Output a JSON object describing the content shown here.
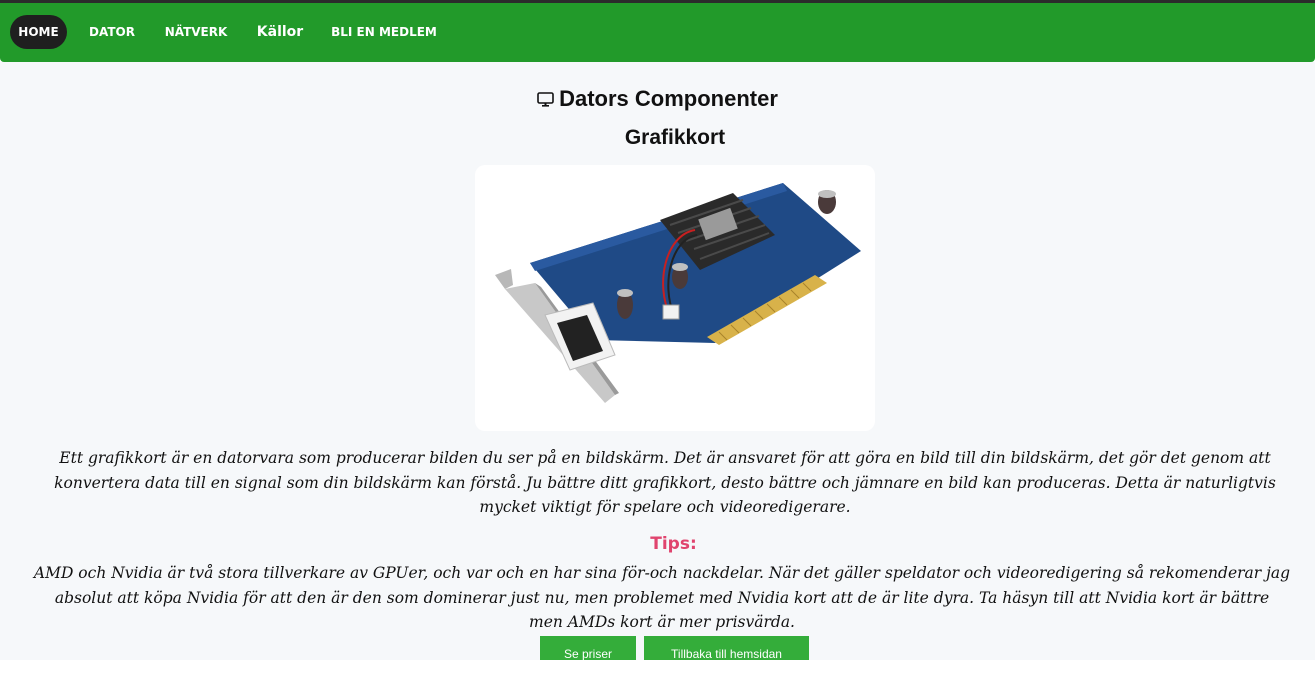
{
  "nav": {
    "items": [
      {
        "label": "HOME"
      },
      {
        "label": "DATOR"
      },
      {
        "label": "NÄTVERK"
      },
      {
        "label": "Källor"
      },
      {
        "label": "BLI EN MEDLEM"
      }
    ]
  },
  "main": {
    "title": "Dators Componenter",
    "title_icon": "monitor-icon",
    "subtitle": "Grafikkort",
    "image_alt": "graphics-card-image",
    "paragraph_lines": [
      "Ett grafikkort är en datorvara som producerar bilden du ser på en bildskärm. Det är ansvaret för att göra en bild till din bildskärm, det gör det genom att",
      "konvertera data till en signal som din bildskärm kan förstå. Ju bättre ditt grafikkort, desto bättre och jämnare en bild kan produceras. Detta är naturligtvis",
      "mycket viktigt för spelare och videoredigerare."
    ],
    "tips_heading": "Tips:",
    "tips_lines": [
      "AMD och Nvidia är två stora tillverkare av GPUer, och var och en har sina för-och nackdelar. När det gäller speldator och videoredigering så rekomenderar jag",
      "absolut att köpa Nvidia för att den är den som dominerar just nu, men problemet med Nvidia kort att de är lite dyra. Ta häsyn till att Nvidia kort är bättre",
      "men AMDs kort är mer prisvärda."
    ],
    "buttons": {
      "prices": "Se priser",
      "back": "Tillbaka till hemsidan"
    }
  },
  "colors": {
    "navbar": "#229a2a",
    "active_nav": "#1f1f1f",
    "tips": "#e0446e",
    "button": "#34ad3a",
    "page_bg": "#f6f8fa"
  }
}
